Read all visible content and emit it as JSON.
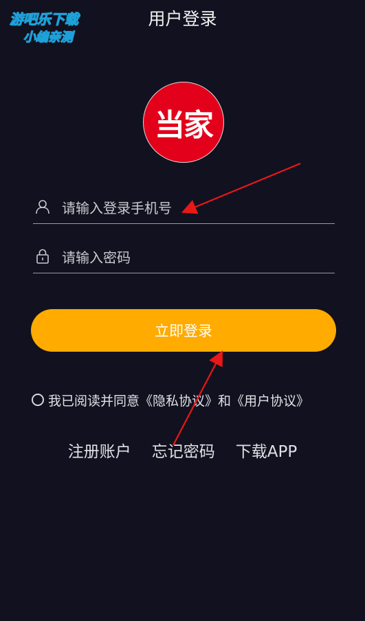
{
  "watermark": {
    "line1": "游吧乐下载",
    "line2": "小编亲测"
  },
  "header": {
    "title": "用户登录"
  },
  "logo": {
    "text": "当家",
    "color": "#e3001b"
  },
  "phone": {
    "placeholder": "请输入登录手机号",
    "value": ""
  },
  "password": {
    "placeholder": "请输入密码",
    "value": ""
  },
  "login": {
    "label": "立即登录",
    "color": "#ffab00"
  },
  "agreement": {
    "prefix": "我已阅读并同意",
    "privacy": "《隐私协议》",
    "and": "和",
    "user": "《用户协议》",
    "checked": false
  },
  "links": {
    "register": "注册账户",
    "forgot": "忘记密码",
    "download": "下载APP"
  },
  "annotation": {
    "arrow_color": "#e81818"
  }
}
